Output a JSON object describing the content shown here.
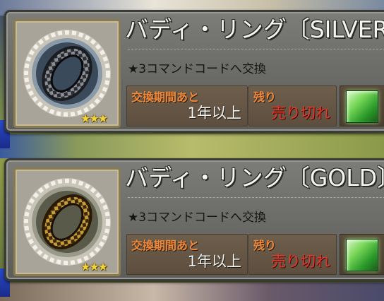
{
  "cards": [
    {
      "title": "バディ・リング〔SILVER〕",
      "description": "★3コマンドコードへ交換",
      "rarity": "★★★",
      "period_label": "交換期間あと",
      "period_value": "1年以上",
      "remaining_label": "残り",
      "remaining_value": "売り切れ",
      "ring_metal": "silver",
      "ring_color": "#5a5e66"
    },
    {
      "title": "バディ・リング〔GOLD〕",
      "description": "★3コマンドコードへ交換",
      "rarity": "★★★",
      "period_label": "交換期間あと",
      "period_value": "1年以上",
      "remaining_label": "残り",
      "remaining_value": "売り切れ",
      "ring_metal": "gold",
      "ring_color": "#7a5a1a"
    }
  ],
  "colors": {
    "label_orange": "#f08a3a",
    "soldout_red": "#e23a2a",
    "star_gold": "#f2d23a",
    "cube_green": "#4ac83a"
  },
  "icons": {
    "item": "ring-icon",
    "currency": "green-cube-icon",
    "frame": "laurel-wreath-icon"
  }
}
